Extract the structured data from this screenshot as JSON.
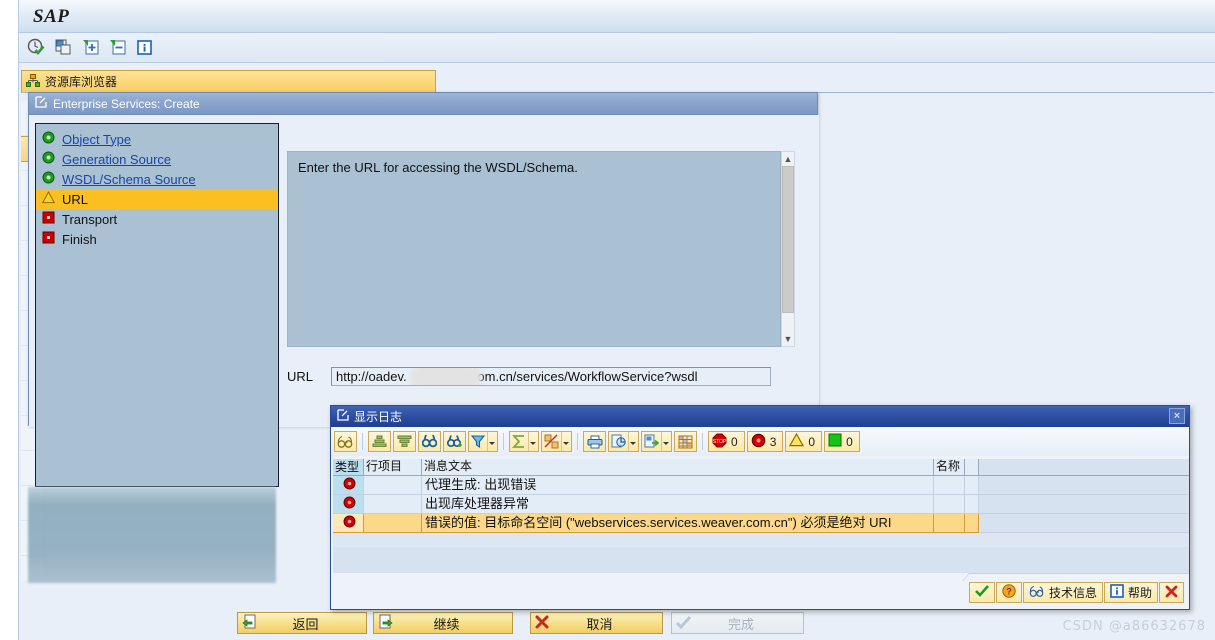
{
  "app": {
    "title": "SAP",
    "toolbar_icons": [
      "execute-check-icon",
      "copy-icon",
      "create-icon",
      "display-icon",
      "info-icon"
    ]
  },
  "breadcrumb": {
    "icon": "repository-browser-icon",
    "label": "资源库浏览器"
  },
  "wizard": {
    "icon": "dialog-icon",
    "title": "Enterprise Services: Create",
    "nav_items": [
      {
        "label": "Object Type",
        "status": "green",
        "link": true,
        "selected": false
      },
      {
        "label": "Generation Source",
        "status": "green",
        "link": true,
        "selected": false
      },
      {
        "label": "WSDL/Schema Source",
        "status": "green",
        "link": true,
        "selected": false
      },
      {
        "label": "URL",
        "status": "yellow",
        "link": false,
        "selected": true
      },
      {
        "label": "Transport",
        "status": "red",
        "link": false,
        "selected": false
      },
      {
        "label": "Finish",
        "status": "red",
        "link": false,
        "selected": false
      }
    ],
    "description": "Enter the URL for accessing the WSDL/Schema.",
    "url_label": "URL",
    "url_value_prefix": "http://oadev.",
    "url_value_suffix": ".com.cn/services/WorkflowService?wsdl",
    "url_value_full": "http://oadev.█████.com.cn/services/WorkflowService?wsdl"
  },
  "wizard_buttons": [
    {
      "label": "返回",
      "icon": "back-icon",
      "enabled": true
    },
    {
      "label": "继续",
      "icon": "continue-icon",
      "enabled": true
    },
    {
      "label": "取消",
      "icon": "cancel-icon",
      "enabled": true
    },
    {
      "label": "完成",
      "icon": "complete-icon",
      "enabled": false
    }
  ],
  "log_dialog": {
    "icon": "dialog-icon",
    "title": "显示日志",
    "close_label": "×",
    "toolbar": {
      "tools": [
        {
          "name": "technical-info-icon",
          "kind": "glasses"
        },
        {
          "name": "sort-ascending-icon",
          "kind": "sort-asc"
        },
        {
          "name": "sort-descending-icon",
          "kind": "sort-desc"
        },
        {
          "name": "find-icon",
          "kind": "binoculars"
        },
        {
          "name": "find-next-icon",
          "kind": "binoculars-plus"
        },
        {
          "name": "filter-icon",
          "kind": "filter",
          "dropdown": true
        },
        {
          "name": "total-icon",
          "kind": "sigma",
          "dropdown": true
        },
        {
          "name": "subtotal-icon",
          "kind": "subtotal",
          "dropdown": true
        },
        {
          "name": "print-icon",
          "kind": "printer"
        },
        {
          "name": "export-local-icon",
          "kind": "local-file",
          "dropdown": true
        },
        {
          "name": "export-icon",
          "kind": "export",
          "dropdown": true
        },
        {
          "name": "layout-icon",
          "kind": "grid"
        }
      ],
      "counters": [
        {
          "name": "abort-count",
          "icon": "stop-icon",
          "value": "0"
        },
        {
          "name": "error-count",
          "icon": "error-icon",
          "value": "3"
        },
        {
          "name": "warning-count",
          "icon": "warning-icon",
          "value": "0"
        },
        {
          "name": "success-count",
          "icon": "success-icon",
          "value": "0"
        }
      ]
    },
    "table": {
      "columns": [
        "类型",
        "行项目",
        "消息文本",
        "名称"
      ],
      "rows": [
        {
          "type": "error",
          "item": "",
          "message": "代理生成: 出现错误",
          "name": "",
          "highlighted": false
        },
        {
          "type": "error",
          "item": "",
          "message": "出现库处理器异常",
          "name": "",
          "highlighted": false
        },
        {
          "type": "error",
          "item": "",
          "message": "错误的值: 目标命名空间 (\"webservices.services.weaver.com.cn\") 必须是绝对 URI",
          "name": "",
          "highlighted": true
        }
      ]
    },
    "actions": [
      {
        "label": "",
        "icon": "confirm-icon"
      },
      {
        "label": "",
        "icon": "help-question-icon"
      },
      {
        "label": "技术信息",
        "icon": "glasses-icon"
      },
      {
        "label": "帮助",
        "icon": "info-icon"
      },
      {
        "label": "",
        "icon": "close-x-icon"
      }
    ]
  },
  "watermark": "CSDN @a86632678",
  "colors": {
    "sap_title_bg": "#dfe9f4",
    "breadcrumb_bg": "#fcd87c",
    "wizard_title_bg": "#8aa4cc",
    "wizard_panel_bg": "#a9c1d3",
    "log_title_bg": "#2b4da0",
    "selected_row_bg": "#fbbf21",
    "highlight_row_bg": "#fcd98a",
    "link_text": "#1c44a8",
    "error_red": "#cc0000",
    "success_green": "#27a327",
    "warning_yellow": "#ffd11a"
  }
}
